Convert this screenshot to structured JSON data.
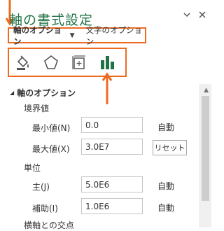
{
  "pane": {
    "title": "軸の書式設定",
    "pin_icon": "chevron-down-icon",
    "close_icon": "close-icon"
  },
  "option_tabs": {
    "axis_options_label": "軸のオプション",
    "text_options_label": "文字のオプション"
  },
  "icon_tabs": [
    {
      "name": "fill-line-icon"
    },
    {
      "name": "effects-icon"
    },
    {
      "name": "size-properties-icon"
    },
    {
      "name": "axis-options-icon"
    }
  ],
  "section": {
    "title": "軸のオプション"
  },
  "bounds": {
    "heading": "境界値",
    "min_label": "最小値(N)",
    "min_value": "0.0",
    "min_unit": "自動",
    "max_label": "最大値(X)",
    "max_value": "3.0E7",
    "max_button": "リセット"
  },
  "units": {
    "heading": "単位",
    "major_label": "主(J)",
    "major_value": "5.0E6",
    "major_unit": "自動",
    "minor_label": "補助(I)",
    "minor_value": "1.0E6",
    "minor_unit": "自動"
  },
  "cross": {
    "heading": "横軸との交点"
  },
  "colors": {
    "accent": "#217346",
    "highlight": "#ed6b21"
  }
}
